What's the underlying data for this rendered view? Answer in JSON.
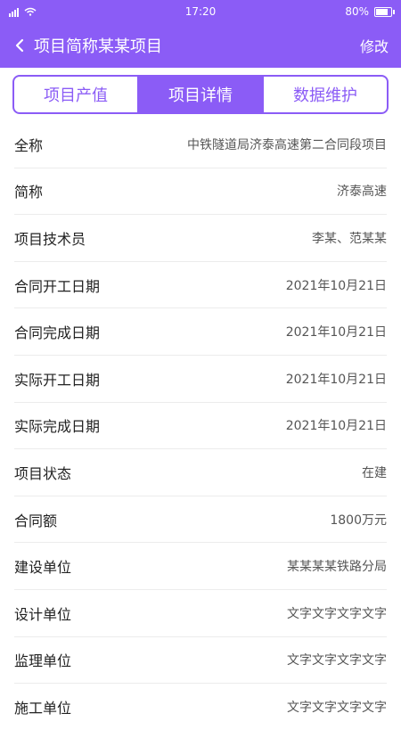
{
  "status": {
    "time": "17:20",
    "battery": "80%"
  },
  "nav": {
    "title": "项目简称某某项目",
    "edit_label": "修改"
  },
  "tabs": [
    {
      "label": "项目产值",
      "active": false
    },
    {
      "label": "项目详情",
      "active": true
    },
    {
      "label": "数据维护",
      "active": false
    }
  ],
  "details": [
    {
      "label": "全称",
      "value": "中铁隧道局济泰高速第二合同段项目"
    },
    {
      "label": "简称",
      "value": "济泰高速"
    },
    {
      "label": "项目技术员",
      "value": "李某、范某某"
    },
    {
      "label": "合同开工日期",
      "value": "2021年10月21日"
    },
    {
      "label": "合同完成日期",
      "value": "2021年10月21日"
    },
    {
      "label": "实际开工日期",
      "value": "2021年10月21日"
    },
    {
      "label": "实际完成日期",
      "value": "2021年10月21日"
    },
    {
      "label": "项目状态",
      "value": "在建"
    },
    {
      "label": "合同额",
      "value": "1800万元"
    },
    {
      "label": "建设单位",
      "value": "某某某某铁路分局"
    },
    {
      "label": "设计单位",
      "value": "文字文字文字文字"
    },
    {
      "label": "监理单位",
      "value": "文字文字文字文字"
    },
    {
      "label": "施工单位",
      "value": "文字文字文字文字"
    }
  ],
  "colors": {
    "accent": "#8b5cf6"
  }
}
